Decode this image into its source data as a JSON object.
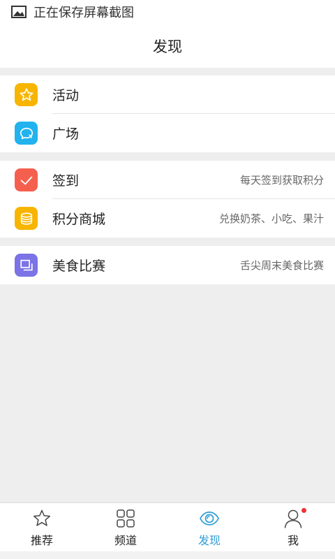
{
  "status_bar": {
    "text": "正在保存屏幕截图",
    "icon": "image-icon"
  },
  "header": {
    "title": "发现"
  },
  "groups": [
    {
      "items": [
        {
          "label": "活动",
          "desc": "",
          "icon": "star-icon",
          "color": "#F7B500"
        },
        {
          "label": "广场",
          "desc": "",
          "icon": "chat-bubbles-icon",
          "color": "#22B2EE"
        }
      ]
    },
    {
      "items": [
        {
          "label": "签到",
          "desc": "每天签到获取积分",
          "icon": "checkmark-icon",
          "color": "#F5604E"
        },
        {
          "label": "积分商城",
          "desc": "兑换奶茶、小吃、果汁",
          "icon": "coin-stack-icon",
          "color": "#F7B500"
        }
      ]
    },
    {
      "items": [
        {
          "label": "美食比赛",
          "desc": "舌尖周末美食比赛",
          "icon": "layers-icon",
          "color": "#7B73E6"
        }
      ]
    }
  ],
  "tabs": [
    {
      "label": "推荐",
      "icon": "star-outline-icon",
      "active": false
    },
    {
      "label": "频道",
      "icon": "grid-icon",
      "active": false
    },
    {
      "label": "发现",
      "icon": "eye-icon",
      "active": true
    },
    {
      "label": "我",
      "icon": "person-icon",
      "active": false,
      "badge": true
    }
  ],
  "colors": {
    "active_tab": "#2F9DD6",
    "badge": "#F2303B",
    "background": "#EEEEEE"
  }
}
